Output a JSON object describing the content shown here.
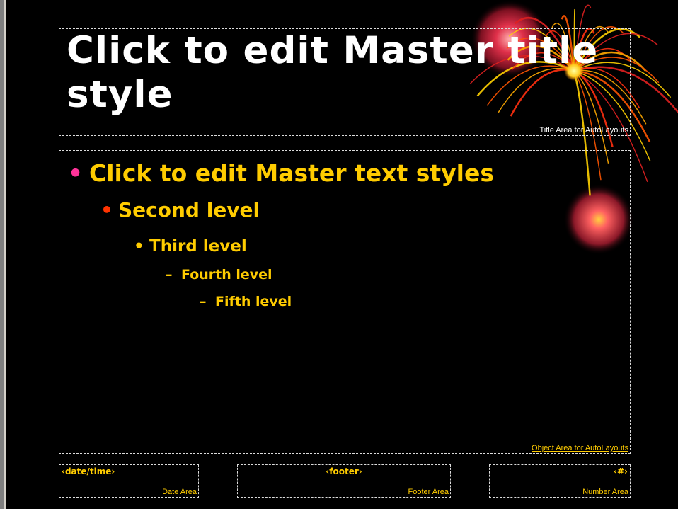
{
  "colors": {
    "background": "#000000",
    "title_text": "#ffffff",
    "body_text": "#ffcc00",
    "bullet_level1": "#ff3399",
    "bullet_level2": "#ff3300",
    "area_label_title": "#ffffff",
    "area_label_other": "#ffcc00",
    "placeholder_border": "#dcdcdc"
  },
  "title_area": {
    "text": "Click to edit Master title style",
    "label": "Title Area for AutoLayouts"
  },
  "object_area": {
    "label": "Object Area for AutoLayouts",
    "levels": [
      {
        "bullet": "•",
        "text": "Click to edit Master text styles"
      },
      {
        "bullet": "•",
        "text": "Second level"
      },
      {
        "bullet": "•",
        "text": "Third level"
      },
      {
        "bullet": "–",
        "text": "Fourth level"
      },
      {
        "bullet": "–",
        "text": "Fifth level"
      }
    ]
  },
  "date_area": {
    "field": "‹date/time›",
    "label": "Date Area"
  },
  "footer_area": {
    "field": "‹footer›",
    "label": "Footer Area"
  },
  "number_area": {
    "field": "‹#›",
    "label": "Number Area"
  },
  "decoration": {
    "icon": "firework-burst-icon"
  }
}
